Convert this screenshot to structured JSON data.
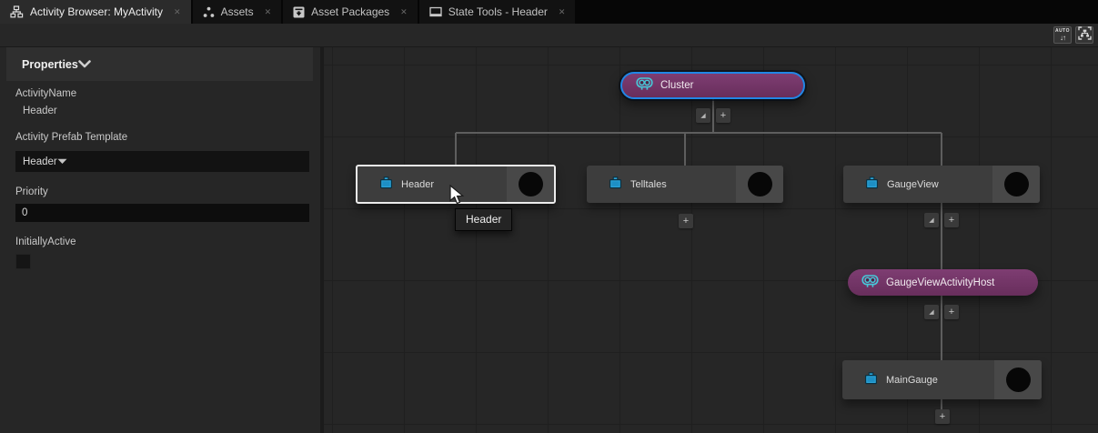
{
  "tabs": [
    {
      "label": "Activity Browser: MyActivity",
      "icon": "activity-browser-icon",
      "active": true
    },
    {
      "label": "Assets",
      "icon": "assets-icon",
      "active": false
    },
    {
      "label": "Asset Packages",
      "icon": "asset-packages-icon",
      "active": false
    },
    {
      "label": "State Tools - Header",
      "icon": "state-tools-icon",
      "active": false
    }
  ],
  "toolbar": {
    "auto_button_label": "AUTO",
    "auto_button_arrows": "↓↑",
    "fit_button": "fit-graph-to-view"
  },
  "properties_panel": {
    "title": "Properties",
    "activity_name": {
      "label": "ActivityName",
      "value": "Header"
    },
    "prefab_template": {
      "label": "Activity Prefab Template",
      "value": "Header"
    },
    "priority": {
      "label": "Priority",
      "value": "0"
    },
    "initially_active": {
      "label": "InitiallyActive",
      "checked": false
    }
  },
  "graph": {
    "nodes": {
      "cluster": {
        "label": "Cluster",
        "type": "activity-host",
        "selected": true
      },
      "header": {
        "label": "Header",
        "type": "activity",
        "hovered": true
      },
      "telltales": {
        "label": "Telltales",
        "type": "activity"
      },
      "gauge_view": {
        "label": "GaugeView",
        "type": "activity"
      },
      "gauge_view_activity_host": {
        "label": "GaugeViewActivityHost",
        "type": "activity-host"
      },
      "main_gauge": {
        "label": "MainGauge",
        "type": "activity"
      }
    },
    "tooltip": {
      "text": "Header"
    }
  },
  "glyphs": {
    "close": "✕",
    "plus": "+",
    "collapse": "◢"
  },
  "colors": {
    "accent_blue": "#2186e6",
    "host_purple": "#7a3a6e",
    "node_gray": "#3d3d3d",
    "canvas": "#262626",
    "grid_line": "#1f1f1f",
    "connection": "#5e5e5e",
    "prefab_icon_blue": "#2aa3d8",
    "robot_icon_teal": "#46c8d8"
  }
}
